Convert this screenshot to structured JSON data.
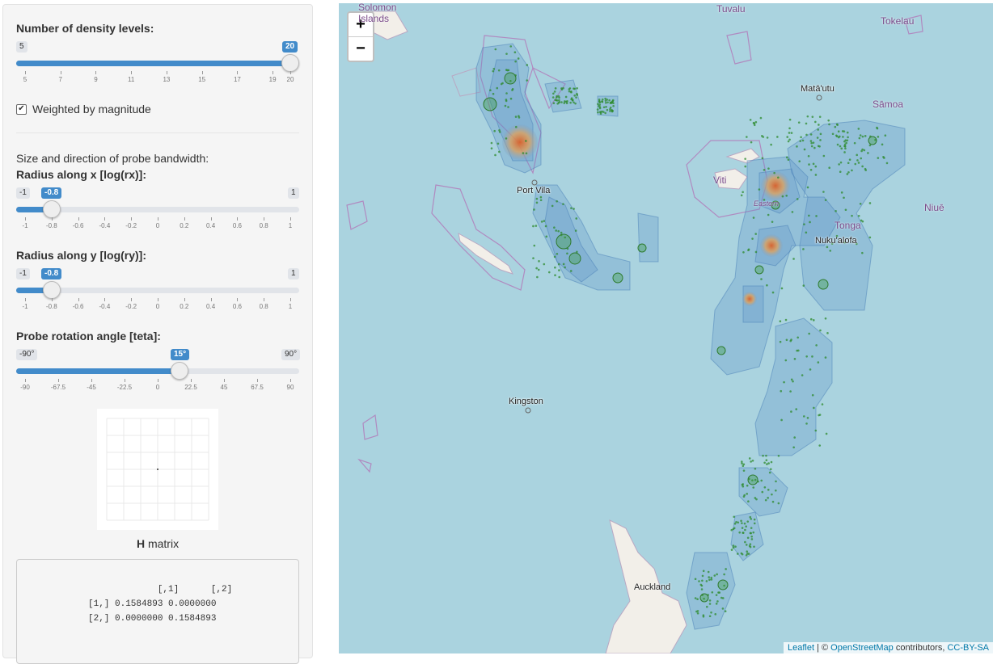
{
  "sidebar": {
    "density": {
      "label": "Number of density levels:",
      "min": "5",
      "max": "20",
      "value": "20",
      "fraction": 1.0,
      "ticks": [
        "5",
        "7",
        "9",
        "11",
        "13",
        "15",
        "17",
        "19",
        "20"
      ]
    },
    "weighted": {
      "label": "Weighted by magnitude",
      "checked": true
    },
    "bandwidth_heading": "Size and direction of probe bandwidth:",
    "rx": {
      "label": "Radius along x [log(rx)]:",
      "min": "-1",
      "max": "1",
      "value": "-0.8",
      "fraction": 0.1,
      "ticks": [
        "-1",
        "-0.8",
        "-0.6",
        "-0.4",
        "-0.2",
        "0",
        "0.2",
        "0.4",
        "0.6",
        "0.8",
        "1"
      ]
    },
    "ry": {
      "label": "Radius along y [log(ry)]:",
      "min": "-1",
      "max": "1",
      "value": "-0.8",
      "fraction": 0.1,
      "ticks": [
        "-1",
        "-0.8",
        "-0.6",
        "-0.4",
        "-0.2",
        "0",
        "0.2",
        "0.4",
        "0.6",
        "0.8",
        "1"
      ]
    },
    "teta": {
      "label": "Probe rotation angle [teta]:",
      "min": "-90°",
      "max": "90°",
      "value": "15°",
      "fraction": 0.5833,
      "ticks": [
        "-90",
        "-67.5",
        "-45",
        "-22.5",
        "0",
        "22.5",
        "45",
        "67.5",
        "90"
      ]
    },
    "h_matrix_caption_bold": "H",
    "h_matrix_caption": " matrix",
    "h_matrix_output": "             [,1]      [,2]\n[1,] 0.1584893 0.0000000\n[2,] 0.0000000 0.1584893"
  },
  "map": {
    "zoom_in": "+",
    "zoom_out": "−",
    "labels": {
      "solomon": "Solomon\nIslands",
      "tuvalu": "Tuvalu",
      "tokelau": "Tokelau",
      "mata_utu": "Matā'utu",
      "samoa": "Sāmoa",
      "viti": "Viti",
      "eastern": "Eastern",
      "port_vila": "Port Vila",
      "tonga": "Tonga",
      "nukualofa": "Nuku'alofa",
      "niue": "Niuē",
      "kingston": "Kingston",
      "auckland": "Auckland"
    },
    "attribution": {
      "leaflet": "Leaflet",
      "sep": " | © ",
      "osm": "OpenStreetMap",
      "contrib": " contributors, ",
      "license": "CC-BY-SA"
    }
  },
  "colors": {
    "accent": "#428bca",
    "water": "#aad3df",
    "density_blue": "#5b8fc7",
    "quake_green": "#2e8b2e",
    "hotspot": "#e07a2e"
  }
}
